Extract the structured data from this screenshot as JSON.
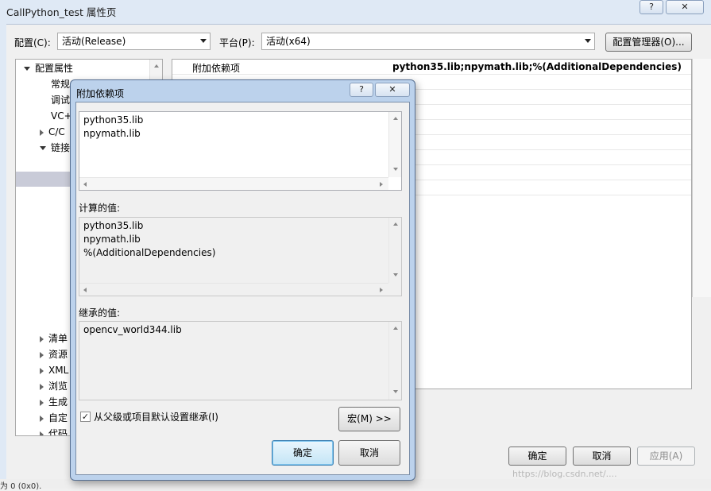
{
  "outer_window": {
    "title": "CallPython_test 属性页",
    "help_button": "?",
    "close_button": "✕",
    "config_label": "配置(C):",
    "config_value": "活动(Release)",
    "platform_label": "平台(P):",
    "platform_value": "活动(x64)",
    "config_manager_button": "配置管理器(O)...",
    "ok_button": "确定",
    "cancel_button": "取消",
    "apply_button": "应用(A)"
  },
  "tree": {
    "root": "配置属性",
    "items": [
      "常规",
      "调试",
      "VC++",
      "C/C",
      "链接",
      "清单",
      "资源",
      "XML",
      "浏览",
      "生成",
      "自定",
      "代码"
    ]
  },
  "property_grid": {
    "selected_name": "附加依赖项",
    "selected_value": "python35.lib;npymath.lib;%(AdditionalDependencies)"
  },
  "dialog": {
    "title": "附加依赖项",
    "help_button": "?",
    "close_button": "✕",
    "entries": [
      "python35.lib",
      "npymath.lib"
    ],
    "evaluated_label": "计算的值:",
    "evaluated_values": [
      "python35.lib",
      "npymath.lib",
      "%(AdditionalDependencies)"
    ],
    "inherited_label": "继承的值:",
    "inherited_values": [
      "opencv_world344.lib"
    ],
    "inherit_checkbox_label": "从父级或项目默认设置继承(I)",
    "inherit_checked": true,
    "macros_button": "宏(M) >>",
    "ok_button": "确定",
    "cancel_button": "取消"
  },
  "watermark": "https://blog.csdn.net/....",
  "status_text": "为 0 (0x0)."
}
